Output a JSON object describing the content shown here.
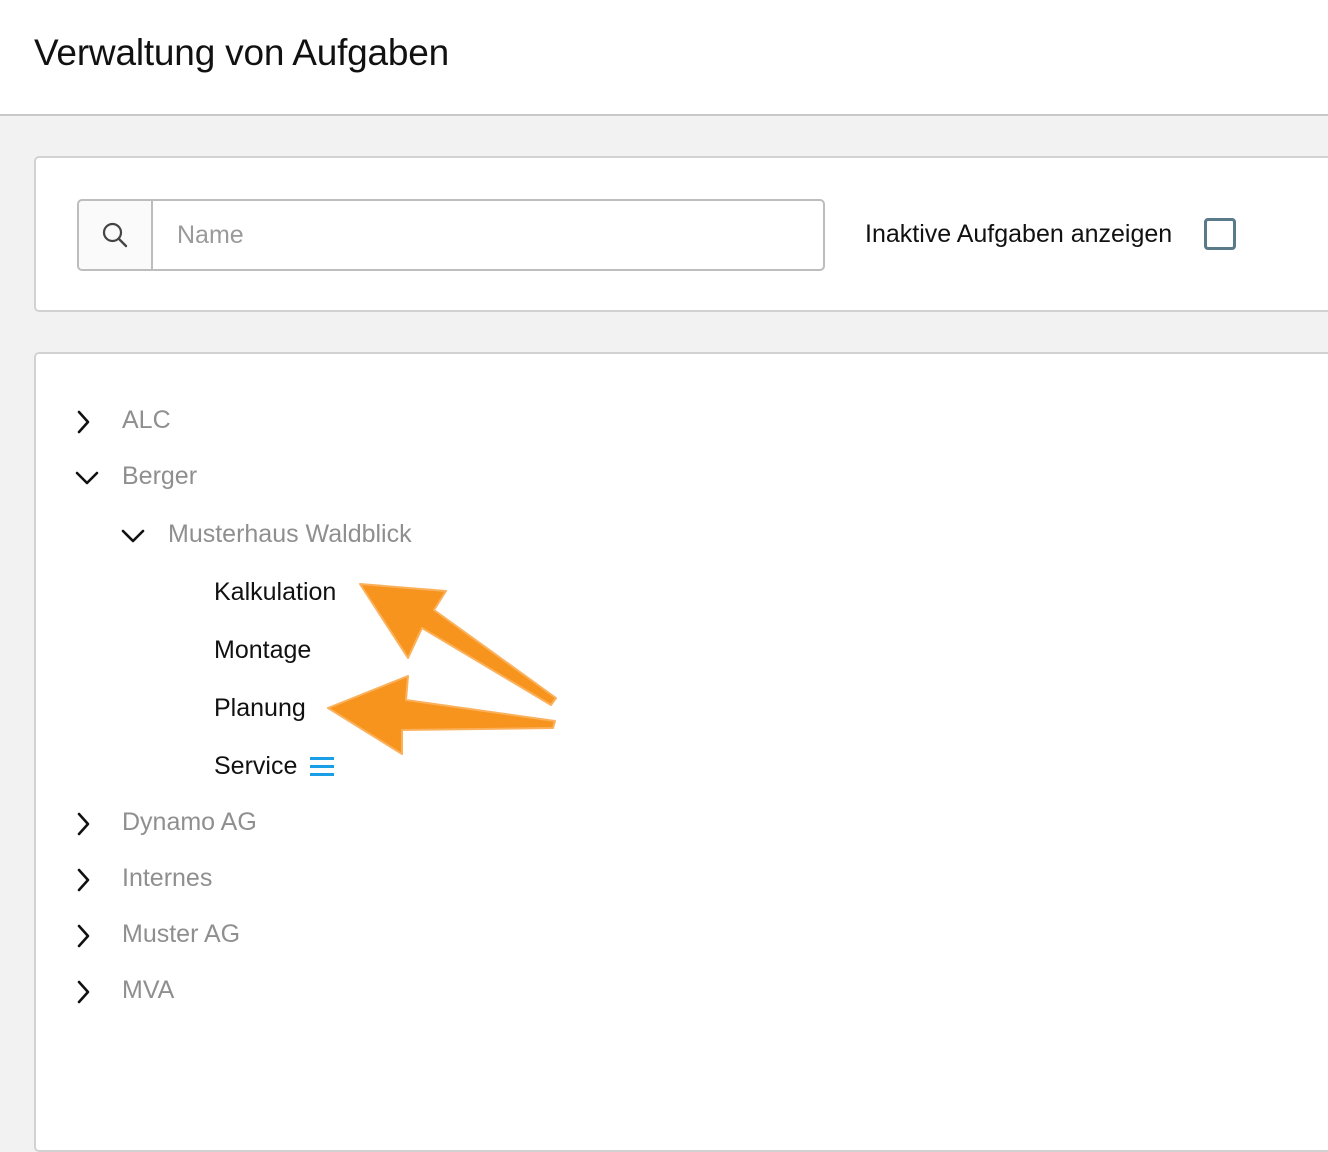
{
  "header": {
    "title": "Verwaltung von Aufgaben"
  },
  "filter": {
    "search_icon": "search-icon",
    "search_placeholder": "Name",
    "search_value": "",
    "inactive_label": "Inaktive Aufgaben anzeigen",
    "inactive_checked": false
  },
  "tree": {
    "nodes": [
      {
        "label": "ALC",
        "state": "collapsed"
      },
      {
        "label": "Berger",
        "state": "expanded",
        "children": [
          {
            "label": "Musterhaus Waldblick",
            "state": "expanded",
            "children": [
              {
                "label": "Kalkulation"
              },
              {
                "label": "Montage"
              },
              {
                "label": "Planung"
              },
              {
                "label": "Service",
                "icon": "menu-icon"
              }
            ]
          }
        ]
      },
      {
        "label": "Dynamo AG",
        "state": "collapsed"
      },
      {
        "label": "Internes",
        "state": "collapsed"
      },
      {
        "label": "Muster AG",
        "state": "collapsed"
      },
      {
        "label": "MVA",
        "state": "collapsed"
      }
    ]
  },
  "colors": {
    "accent_arrow": "#f7941d",
    "menu_icon": "#1a9ee6",
    "checkbox_border": "#5a7a8a",
    "muted_text": "#8f8f8f"
  }
}
